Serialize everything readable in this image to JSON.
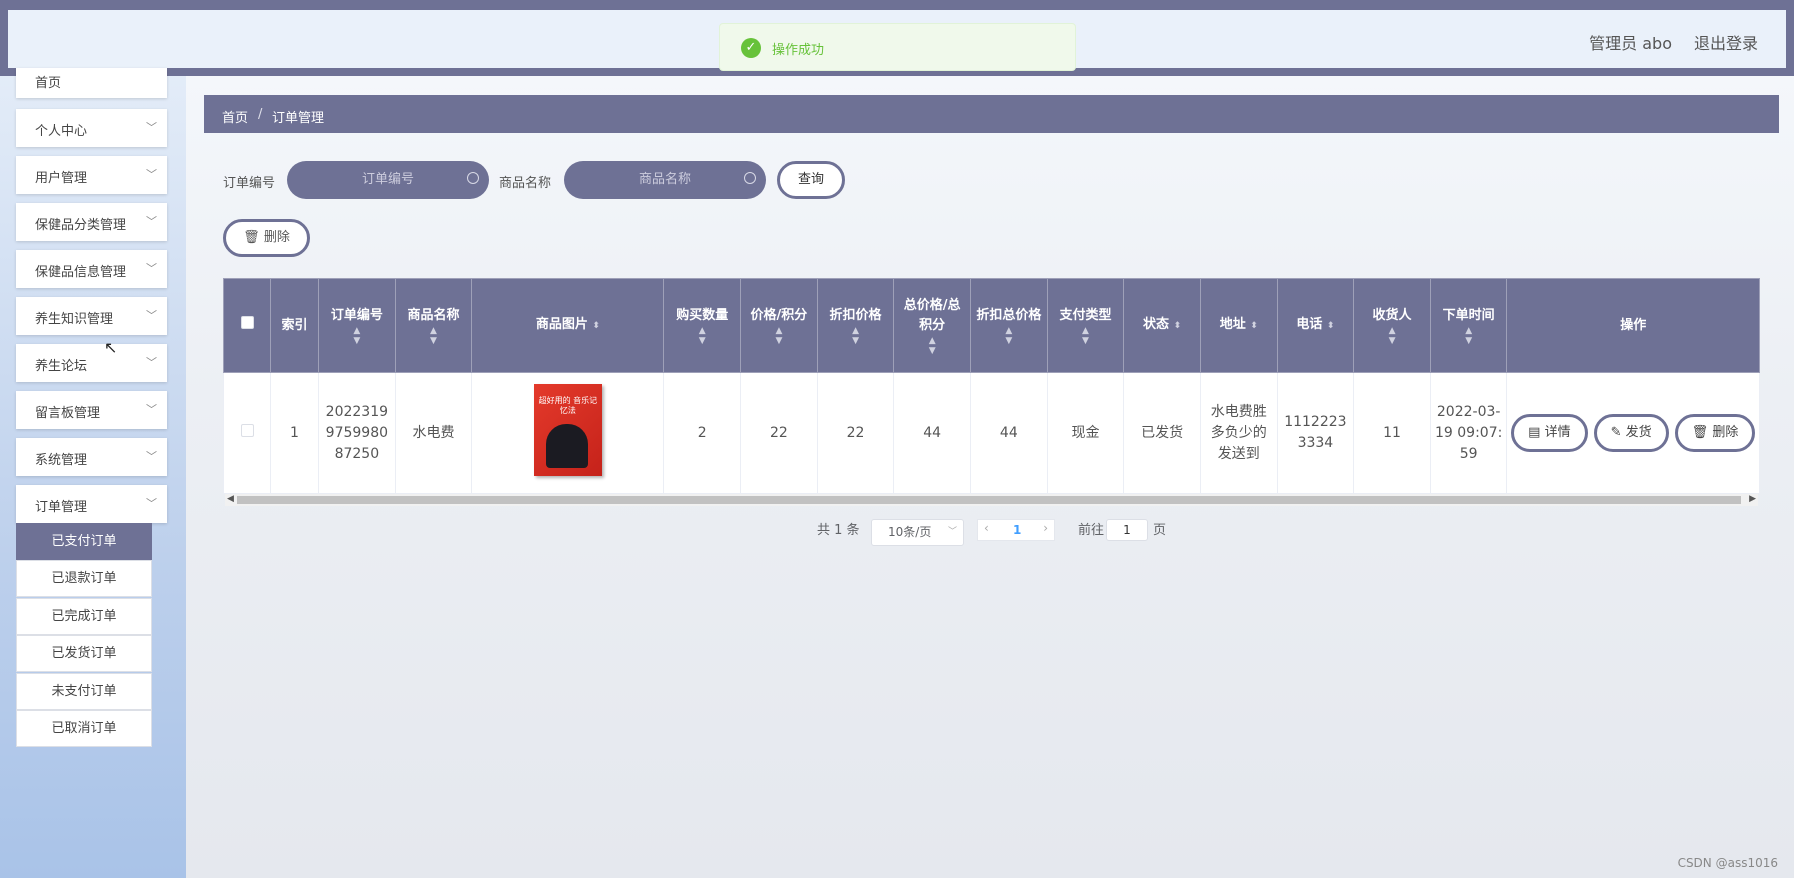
{
  "header": {
    "user": "管理员 abo",
    "logout": "退出登录"
  },
  "toast": {
    "text": "操作成功"
  },
  "sidebar": {
    "items": [
      {
        "label": "首页"
      },
      {
        "label": "个人中心"
      },
      {
        "label": "用户管理"
      },
      {
        "label": "保健品分类管理"
      },
      {
        "label": "保健品信息管理"
      },
      {
        "label": "养生知识管理"
      },
      {
        "label": "养生论坛"
      },
      {
        "label": "留言板管理"
      },
      {
        "label": "系统管理"
      },
      {
        "label": "订单管理"
      }
    ],
    "subitems": [
      {
        "label": "已支付订单",
        "active": true
      },
      {
        "label": "已退款订单"
      },
      {
        "label": "已完成订单"
      },
      {
        "label": "已发货订单"
      },
      {
        "label": "未支付订单"
      },
      {
        "label": "已取消订单"
      }
    ]
  },
  "breadcrumb": {
    "home": "首页",
    "sep": "/",
    "current": "订单管理"
  },
  "search": {
    "order_no_label": "订单编号",
    "order_no_placeholder": "订单编号",
    "product_label": "商品名称",
    "product_placeholder": "商品名称",
    "query": "查询"
  },
  "toolbar": {
    "delete": "删除"
  },
  "table": {
    "headers": [
      "索引",
      "订单编号",
      "商品名称",
      "商品图片",
      "购买数量",
      "价格/积分",
      "折扣价格",
      "总价格/总积分",
      "折扣总价格",
      "支付类型",
      "状态",
      "地址",
      "电话",
      "收货人",
      "下单时间",
      "操作"
    ],
    "rows": [
      {
        "index": "1",
        "order_no": "20223199759980 87250",
        "product": "水电费",
        "book_title": "超好用的 音乐记忆法",
        "qty": "2",
        "price": "22",
        "discount_price": "22",
        "total": "44",
        "discount_total": "44",
        "pay_type": "现金",
        "status": "已发货",
        "address": "水电费胜多负少的发送到",
        "phone": "11122233334",
        "receiver": "11",
        "order_time": "2022-03-19 09:07:59",
        "actions": {
          "detail": "详情",
          "ship": "发货",
          "delete": "删除"
        }
      }
    ]
  },
  "pager": {
    "total": "共 1 条",
    "page_size": "10条/页",
    "current_page": "1",
    "goto_prefix": "前往",
    "goto_value": "1",
    "goto_suffix": "页"
  },
  "watermark": "CSDN @ass1016",
  "colors": {
    "accent": "#6e7195",
    "success": "#67c23a"
  }
}
